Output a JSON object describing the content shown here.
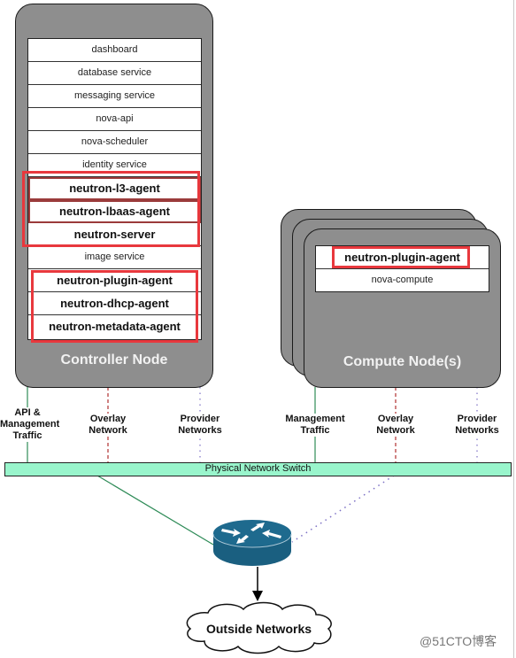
{
  "controller_node": {
    "label": "Controller Node",
    "services": [
      {
        "name": "dashboard",
        "emphasis": false
      },
      {
        "name": "database service",
        "emphasis": false
      },
      {
        "name": "messaging service",
        "emphasis": false
      },
      {
        "name": "nova-api",
        "emphasis": false
      },
      {
        "name": "nova-scheduler",
        "emphasis": false
      },
      {
        "name": "identity service",
        "emphasis": false
      },
      {
        "name": "neutron-l3-agent",
        "emphasis": true
      },
      {
        "name": "neutron-lbaas-agent",
        "emphasis": true
      },
      {
        "name": "neutron-server",
        "emphasis": true
      },
      {
        "name": "image service",
        "emphasis": false
      },
      {
        "name": "neutron-plugin-agent",
        "emphasis": true
      },
      {
        "name": "neutron-dhcp-agent",
        "emphasis": true
      },
      {
        "name": "neutron-metadata-agent",
        "emphasis": true
      }
    ]
  },
  "compute_node": {
    "label": "Compute Node(s)",
    "services": [
      {
        "name": "neutron-plugin-agent",
        "emphasis": true
      },
      {
        "name": "nova-compute",
        "emphasis": false
      }
    ]
  },
  "networks": {
    "controller": {
      "management": [
        "API &",
        "Management",
        "Traffic"
      ],
      "overlay": [
        "Overlay",
        "Network"
      ],
      "provider": [
        "Provider",
        "Networks"
      ]
    },
    "compute": {
      "management": [
        "Management",
        "Traffic"
      ],
      "overlay": [
        "Overlay",
        "Network"
      ],
      "provider": [
        "Provider",
        "Networks"
      ]
    }
  },
  "switch": {
    "label": "Physical Network Switch"
  },
  "router": {
    "icon": "router-icon"
  },
  "outside": {
    "label": "Outside Networks"
  },
  "watermark": "@51CTO博客",
  "colors": {
    "highlight": "#e8383d",
    "management_line": "#2e8b57",
    "overlay_line": "#b03030",
    "provider_line": "#7b6fc4",
    "switch_fill": "#99f5cc",
    "node_fill": "#8e8e8e",
    "router_fill": "#1e6a8e"
  }
}
